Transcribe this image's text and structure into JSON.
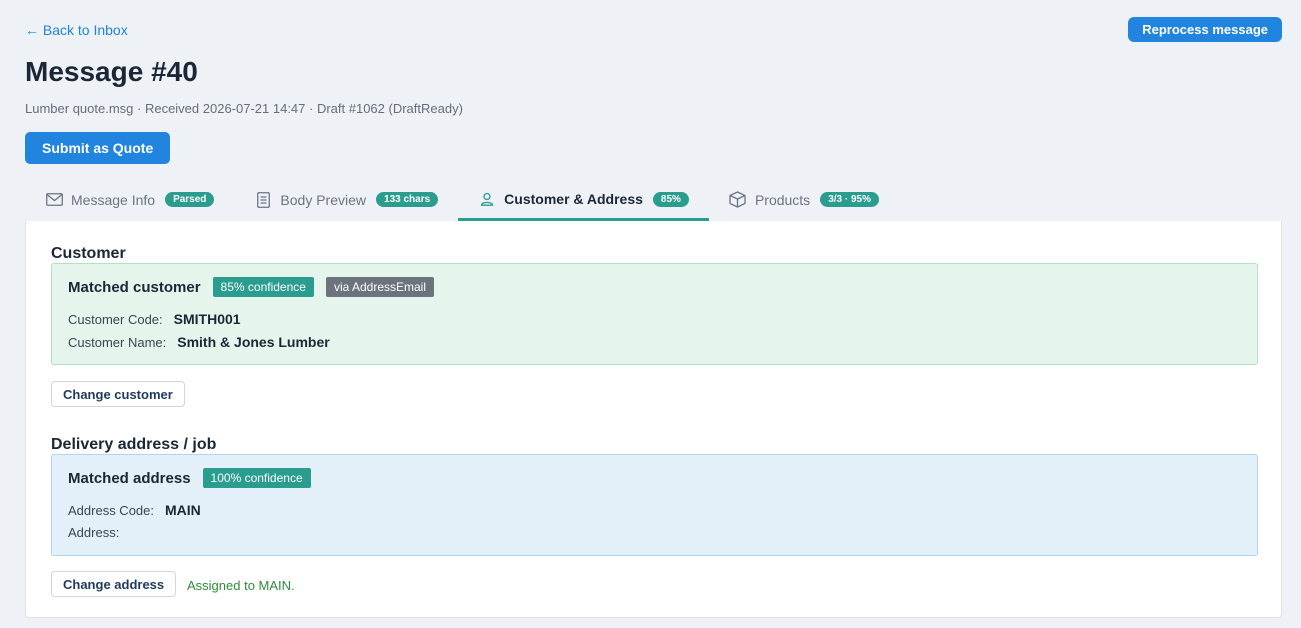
{
  "header": {
    "back_label": "← Back to Inbox",
    "reprocess_label": "Reprocess message",
    "title": "Message #40",
    "subtitle": "Lumber quote.msg · Received 2026-07-21 14:47 · Draft #1062 (DraftReady)",
    "submit_label": "Submit as Quote"
  },
  "tabs": [
    {
      "label": "Message Info",
      "badge": "Parsed",
      "icon": "envelope-icon",
      "active": false
    },
    {
      "label": "Body Preview",
      "badge": "133 chars",
      "icon": "document-icon",
      "active": false
    },
    {
      "label": "Customer & Address",
      "badge": "85%",
      "icon": "user-icon",
      "active": true
    },
    {
      "label": "Products",
      "badge": "3/3 · 95%",
      "icon": "box-icon",
      "active": false
    }
  ],
  "customer": {
    "section_title": "Customer",
    "match_title": "Matched customer",
    "confidence": "85% confidence",
    "via": "via AddressEmail",
    "code_label": "Customer Code:",
    "code_value": "SMITH001",
    "name_label": "Customer Name:",
    "name_value": "Smith & Jones Lumber",
    "change_label": "Change customer"
  },
  "address": {
    "section_title": "Delivery address / job",
    "match_title": "Matched address",
    "confidence": "100% confidence",
    "code_label": "Address Code:",
    "code_value": "MAIN",
    "address_label": "Address:",
    "address_value": "",
    "change_label": "Change address",
    "status_note": "Assigned to MAIN."
  },
  "colors": {
    "accent": "#2185e0",
    "teal": "#2a9d8f",
    "customer_bg": "#e5f5ec",
    "address_bg": "#e3f0fa",
    "success_text": "#2e8b3a"
  }
}
